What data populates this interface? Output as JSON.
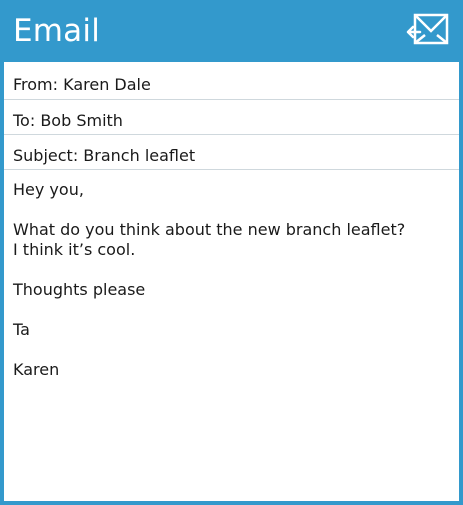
{
  "app": {
    "title": "Email",
    "icon": "mail-icon",
    "accent_color": "#3399cc"
  },
  "email": {
    "from": "From: Karen Dale",
    "to": "To: Bob Smith",
    "subject": "Subject: Branch leaflet",
    "body": [
      "Hey you,",
      "What do you think about the new branch leaflet? I think it’s cool.",
      "Thoughts please",
      "Ta",
      "Karen"
    ]
  }
}
